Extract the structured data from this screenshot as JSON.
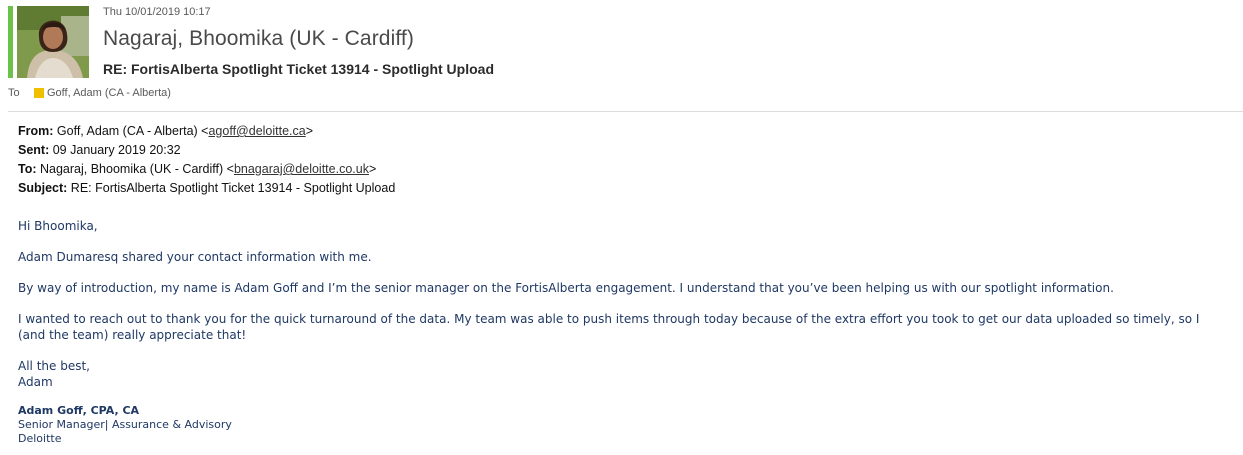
{
  "header": {
    "timestamp": "Thu 10/01/2019 10:17",
    "sender": "Nagaraj, Bhoomika (UK - Cardiff)",
    "subject": "RE: FortisAlberta Spotlight Ticket 13914 - Spotlight Upload",
    "to_label": "To",
    "recipient": "Goff, Adam (CA - Alberta)",
    "presence_color": "#6bc24a",
    "recipient_status_color": "#f0c000"
  },
  "original": {
    "from_label": "From:",
    "from_name": "Goff, Adam (CA - Alberta) <",
    "from_email": "agoff@deloitte.ca",
    "from_close": ">",
    "sent_label": "Sent:",
    "sent_value": "09 January 2019 20:32",
    "to_label": "To:",
    "to_name": "Nagaraj, Bhoomika (UK - Cardiff) <",
    "to_email": "bnagaraj@deloitte.co.uk",
    "to_close": ">",
    "subject_label": "Subject:",
    "subject_value": "RE: FortisAlberta Spotlight Ticket 13914 - Spotlight Upload"
  },
  "message": {
    "greeting": "Hi Bhoomika,",
    "p1": "Adam Dumaresq shared your contact information with me.",
    "p2": "By way of introduction, my name is Adam Goff and I’m the senior manager on the FortisAlberta engagement. I understand that you’ve been helping us with our spotlight information.",
    "p3_line1": "I wanted to reach out to thank you for the quick turnaround of the data. My team was able to push items through today because of the extra effort you took to get our data uploaded so timely, so I",
    "p3_line2": "(and the team) really appreciate that!",
    "signoff": "All the best,",
    "signoff_name": "Adam"
  },
  "signature": {
    "name": "Adam Goff, CPA, CA",
    "title": "Senior Manager| Assurance & Advisory",
    "company": "Deloitte"
  }
}
